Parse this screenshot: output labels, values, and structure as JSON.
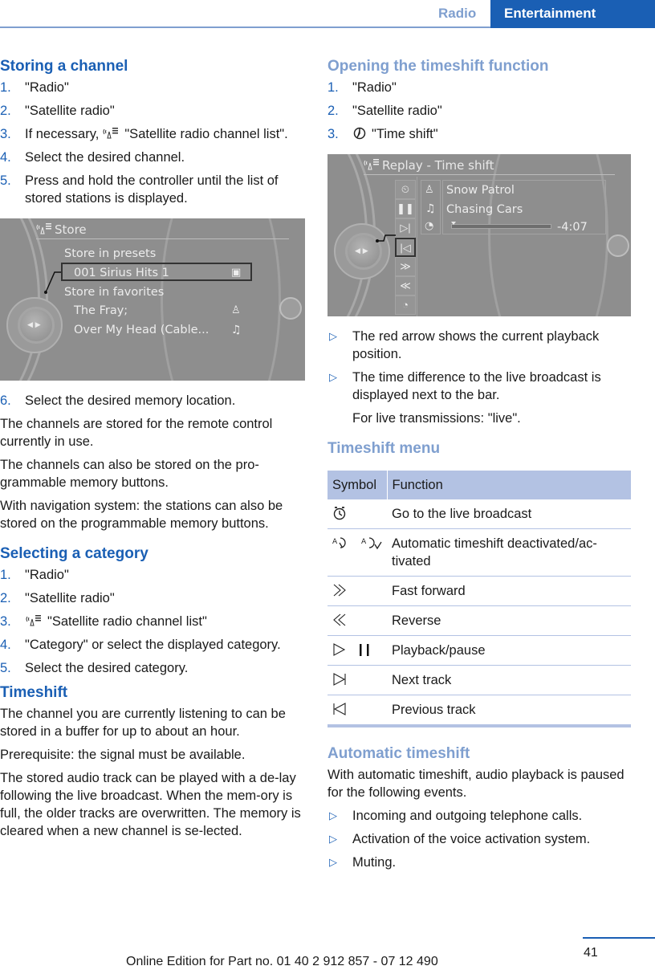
{
  "header": {
    "section": "Radio",
    "chapter": "Entertainment"
  },
  "storing": {
    "heading": "Storing a channel",
    "steps": [
      {
        "num": "1.",
        "text": "\"Radio\""
      },
      {
        "num": "2.",
        "text": "\"Satellite radio\""
      },
      {
        "num": "3.",
        "pre": "If necessary,",
        "icon": "satellite-list-icon",
        "text": "\"Satellite radio channel list\"."
      },
      {
        "num": "4.",
        "text": "Select the desired channel."
      },
      {
        "num": "5.",
        "text": "Press and hold the controller until the list of stored stations is displayed."
      }
    ],
    "screen": {
      "title": "Store",
      "title_icon": "satellite-list-icon",
      "rows": [
        {
          "text": "Store in presets",
          "type": "header"
        },
        {
          "text": "001   Sirius Hits 1",
          "type": "selected",
          "icon": "save-icon"
        },
        {
          "text": "Store in favorites",
          "type": "header"
        },
        {
          "text": "The Fray;",
          "type": "item",
          "icon": "artist-icon"
        },
        {
          "text": "Over My Head (Cable...",
          "type": "item",
          "icon": "music-note-icon"
        }
      ]
    },
    "step6": {
      "num": "6.",
      "text": "Select the desired memory location."
    },
    "paragraphs": [
      "The channels are stored for the remote control currently in use.",
      "The channels can also be stored on the pro-grammable memory buttons.",
      "With navigation system: the stations can also be stored on the programmable memory buttons."
    ]
  },
  "category": {
    "heading": "Selecting a category",
    "steps": [
      {
        "num": "1.",
        "text": "\"Radio\""
      },
      {
        "num": "2.",
        "text": "\"Satellite radio\""
      },
      {
        "num": "3.",
        "icon": "satellite-list-icon",
        "text": "\"Satellite radio channel list\""
      },
      {
        "num": "4.",
        "text": "\"Category\" or select the displayed category."
      },
      {
        "num": "5.",
        "text": "Select the desired category."
      }
    ]
  },
  "timeshift": {
    "heading": "Timeshift",
    "paragraphs": [
      "The channel you are currently listening to can be stored in a buffer for up to about an hour.",
      "Prerequisite: the signal must be available.",
      "The stored audio track can be played with a de-lay following the live broadcast. When the mem-ory is full, the older tracks are overwritten. The memory is cleared when a new channel is se-lected."
    ]
  },
  "opening": {
    "heading": "Opening the timeshift function",
    "steps": [
      {
        "num": "1.",
        "text": "\"Radio\""
      },
      {
        "num": "2.",
        "text": "\"Satellite radio\""
      },
      {
        "num": "3.",
        "icon": "timeshift-icon",
        "text": "\"Time shift\""
      }
    ],
    "screen": {
      "title": "Replay - Time shift",
      "title_icon": "satellite-list-icon",
      "artist": "Snow Patrol",
      "track": "Chasing Cars",
      "time_diff": "-4:07",
      "playback_position": 0.02,
      "buttons": [
        "live-icon",
        "pause-icon",
        "next-track-icon",
        "previous-track-icon",
        "fast-forward-icon",
        "reverse-icon",
        "auto-timeshift-icon"
      ],
      "selected_button": "previous-track-icon"
    },
    "bullets": [
      "The red arrow shows the current playback position.",
      "The time difference to the live broadcast is displayed next to the bar."
    ],
    "note": "For live transmissions: \"live\"."
  },
  "menu": {
    "heading": "Timeshift menu",
    "columns": [
      "Symbol",
      "Function"
    ],
    "rows": [
      {
        "symbols": [
          "live-icon"
        ],
        "function": "Go to the live broadcast"
      },
      {
        "symbols": [
          "auto-timeshift-off-icon",
          "auto-timeshift-on-icon"
        ],
        "function": "Automatic timeshift deactivated/ac-tivated"
      },
      {
        "symbols": [
          "fast-forward-icon"
        ],
        "function": "Fast forward"
      },
      {
        "symbols": [
          "reverse-icon"
        ],
        "function": "Reverse"
      },
      {
        "symbols": [
          "play-icon",
          "pause-icon"
        ],
        "function": "Playback/pause"
      },
      {
        "symbols": [
          "next-track-icon"
        ],
        "function": "Next track"
      },
      {
        "symbols": [
          "previous-track-icon"
        ],
        "function": "Previous track"
      }
    ]
  },
  "auto": {
    "heading": "Automatic timeshift",
    "intro": "With automatic timeshift, audio playback is paused for the following events.",
    "bullets": [
      "Incoming and outgoing telephone calls.",
      "Activation of the voice activation system.",
      "Muting."
    ]
  },
  "footer": {
    "page": "41",
    "edition": "Online Edition for Part no. 01 40 2 912 857 - 07 12 490"
  },
  "bullet_glyph": "▷",
  "colors": {
    "brand_blue": "#1a5fb4",
    "light_blue": "#7f9fcf",
    "table_header": "#b3c2e3"
  }
}
